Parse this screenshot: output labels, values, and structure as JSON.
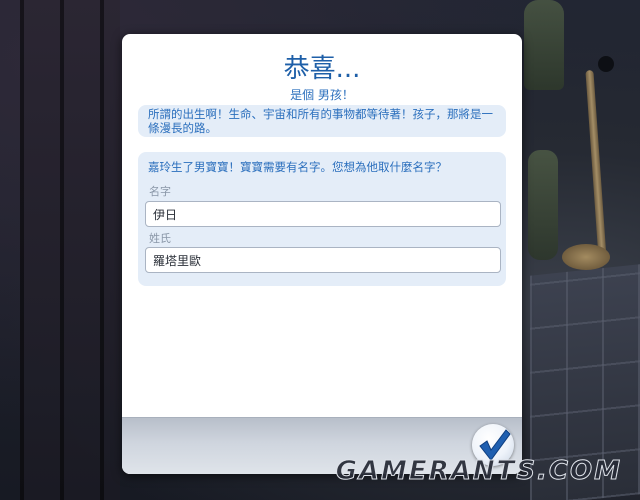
{
  "dialog": {
    "title": "恭喜...",
    "subtitle": "是個 男孩！",
    "flavor_text": "所謂的出生啊！生命、宇宙和所有的事物都等待著！孩子，那將是一條漫長的路。",
    "prompt": "嘉玲生了男寶寶！寶寶需要有名字。您想為他取什麼名字？",
    "first_name": {
      "label": "名字",
      "value": "伊日"
    },
    "last_name": {
      "label": "姓氏",
      "value": "羅塔里歐"
    },
    "confirm_icon": "checkmark-icon"
  },
  "watermark": "GAMERANTS.COM",
  "colors": {
    "title_blue": "#1e5fa8",
    "text_blue": "#2b6fbd",
    "panel_bg": "#e4edf8",
    "check_blue": "#1f5fb0"
  }
}
